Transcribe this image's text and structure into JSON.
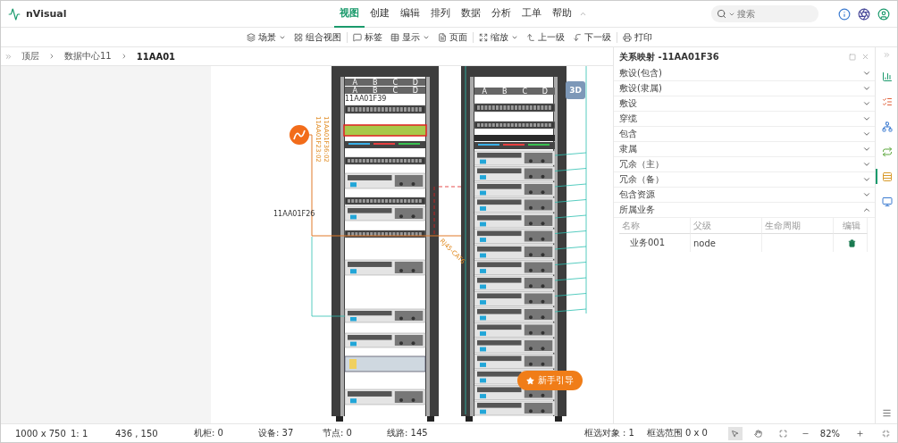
{
  "app": {
    "name": "nVisual"
  },
  "menu": [
    {
      "label": "视图",
      "selected": true
    },
    {
      "label": "创建",
      "selected": false
    },
    {
      "label": "编辑",
      "selected": false
    },
    {
      "label": "排列",
      "selected": false
    },
    {
      "label": "数据",
      "selected": false
    },
    {
      "label": "分析",
      "selected": false
    },
    {
      "label": "工单",
      "selected": false
    },
    {
      "label": "帮助",
      "selected": false
    }
  ],
  "search": {
    "placeholder": "搜索"
  },
  "toolbar": [
    {
      "label": "场景",
      "dropdown": true
    },
    {
      "label": "组合视图",
      "dropdown": false
    },
    {
      "label": "标签",
      "dropdown": false
    },
    {
      "label": "显示",
      "dropdown": true
    },
    {
      "label": "页面",
      "dropdown": false
    },
    {
      "label": "缩放",
      "dropdown": true
    },
    {
      "label": "上一级",
      "dropdown": false
    },
    {
      "label": "下一级",
      "dropdown": false
    },
    {
      "label": "打印",
      "dropdown": false
    }
  ],
  "breadcrumb": [
    "顶层",
    "数据中心11",
    "11AA01"
  ],
  "canvas": {
    "panel_ports": [
      [
        "A",
        "B",
        "C",
        "D"
      ],
      [
        "A",
        "B",
        "C",
        "D"
      ],
      [
        "A",
        "B",
        "C",
        "D"
      ]
    ],
    "rack_label": "11AA01F39",
    "device_label": "11AA01F26",
    "cable_labels": [
      "11AA01F23:02",
      "11AA01F36:02"
    ],
    "cable_type": "RJ45-CAT6",
    "view_3d": "3D",
    "guide": "新手引导"
  },
  "panel": {
    "title": "关系映射 -11AA01F36",
    "sections": [
      {
        "label": "敷设(包含)",
        "expanded": false
      },
      {
        "label": "敷设(隶属)",
        "expanded": false
      },
      {
        "label": "敷设",
        "expanded": false
      },
      {
        "label": "穿缆",
        "expanded": false
      },
      {
        "label": "包含",
        "expanded": false
      },
      {
        "label": "隶属",
        "expanded": false
      },
      {
        "label": "冗余（主）",
        "expanded": false
      },
      {
        "label": "冗余（备）",
        "expanded": false
      },
      {
        "label": "包含资源",
        "expanded": false
      },
      {
        "label": "所属业务",
        "expanded": true
      }
    ],
    "table": {
      "columns": [
        "名称",
        "父级",
        "生命周期",
        "编辑"
      ],
      "rows": [
        {
          "name": "业务001",
          "parent": "node"
        }
      ]
    }
  },
  "side_tools": [
    {
      "selected": false
    },
    {
      "selected": false
    },
    {
      "selected": false
    },
    {
      "selected": false
    },
    {
      "selected": true
    },
    {
      "selected": false
    }
  ],
  "status_bar": {
    "left": [
      "1000 x 750",
      "1: 1",
      "436 , 150"
    ],
    "counts": [
      "机柜: 0",
      "设备: 37",
      "节点: 0",
      "线路: 145"
    ],
    "selection": [
      "框选对象 : 1",
      "框选范围 0 x 0"
    ],
    "tools": [
      {
        "selected": true
      },
      {
        "selected": false
      }
    ],
    "zoom": "82%"
  }
}
